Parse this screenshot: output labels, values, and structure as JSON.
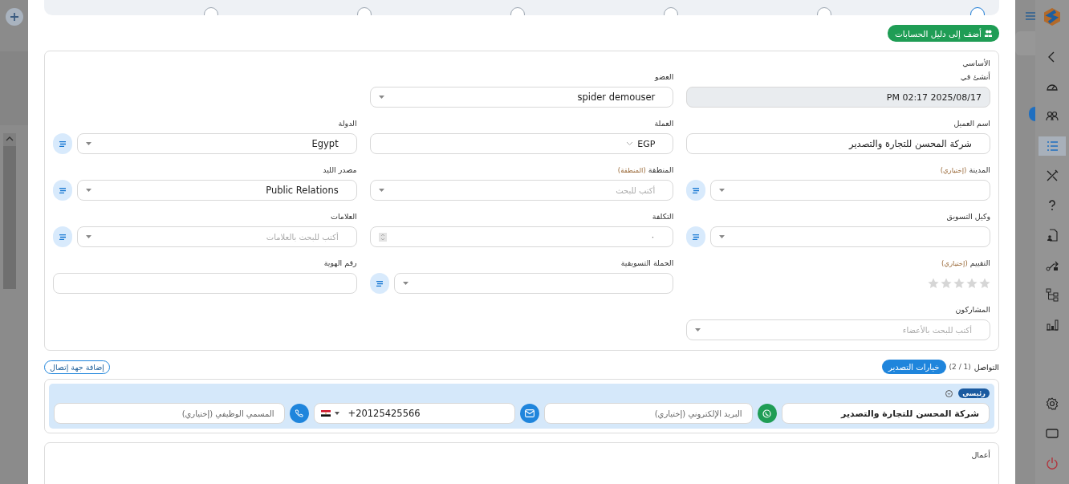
{
  "backdrop": {
    "sidebar": {
      "items": [
        {
          "kind": "back",
          "selected": false
        },
        {
          "kind": "gauge",
          "selected": false
        },
        {
          "kind": "people",
          "selected": false
        },
        {
          "kind": "list",
          "selected": true
        },
        {
          "kind": "tools",
          "selected": false
        },
        {
          "kind": "question",
          "selected": false
        },
        {
          "kind": "file",
          "selected": false
        },
        {
          "kind": "flow",
          "selected": false
        },
        {
          "kind": "tree",
          "selected": false
        },
        {
          "kind": "chart",
          "selected": false
        }
      ],
      "bottom_items": [
        {
          "kind": "gear",
          "selected": false
        },
        {
          "kind": "screen",
          "selected": false
        },
        {
          "kind": "power",
          "selected": false
        }
      ]
    }
  },
  "modal": {
    "stepper": {
      "steps": [
        {
          "selected": true
        },
        {
          "selected": false
        },
        {
          "selected": false
        },
        {
          "selected": false
        },
        {
          "selected": false
        },
        {
          "selected": false
        }
      ]
    },
    "add_to_accounts_button": "أضف إلى دليل الحسابات",
    "basic_section": {
      "title": "الأساسي",
      "rows": [
        [
          {
            "label": "أنشئ في",
            "kind": "readonly",
            "value": "PM 02:17 2025/08/17"
          },
          {
            "label": "العضو",
            "kind": "select",
            "value": "spider demouser"
          }
        ],
        [
          {
            "label": "اسم العميل",
            "kind": "input",
            "value": "شركة المحسن للتجارة والتصدير"
          },
          {
            "label": "العملة",
            "kind": "currency",
            "value": "EGP"
          },
          {
            "label": "الدولة",
            "kind": "select",
            "value": "Egypt",
            "side_button": true
          }
        ],
        [
          {
            "label": "المدينة",
            "hint": "(إختياري)",
            "kind": "select",
            "side_button": true
          },
          {
            "label": "المنطقة",
            "hint": "(المنطقة)",
            "kind": "select",
            "placeholder": "أكتب للبحث"
          },
          {
            "label": "مصدر الليد",
            "kind": "select",
            "value": "Public Relations",
            "side_button": true
          }
        ],
        [
          {
            "label": "وكيل التسويق",
            "kind": "select",
            "side_button": true
          },
          {
            "label": "التكلفة",
            "kind": "number",
            "placeholder": "٠"
          },
          {
            "label": "العلامات",
            "kind": "select",
            "placeholder": "أكتب للبحث بالعلامات",
            "side_button": true
          }
        ],
        [
          {
            "label": "التقييم",
            "hint": "(إختياري)",
            "kind": "stars",
            "stars": 0
          },
          {
            "label": "الحملة التسويقية",
            "kind": "select",
            "side_button": true
          },
          {
            "label": "رقم الهوية",
            "kind": "input"
          }
        ],
        [
          {
            "label": "المشاركون",
            "kind": "select",
            "placeholder": "أكتب للبحث بالأعضاء"
          }
        ]
      ]
    },
    "contacts_section": {
      "title": "التواصل",
      "count": "(2 / 1)",
      "export_button": "خيارات التصدير",
      "add_contact_button": "إضافة جهة إتصال",
      "contacts": [
        {
          "expanded": true,
          "badge": "رئيسي",
          "name": "شركة المحسن للتجارة والتصدير",
          "email_placeholder": "البريد الإلكتروني (إختياري)",
          "phone": "+20125425566",
          "job_title_placeholder": "المسمي الوظيفي (إختياري)"
        }
      ]
    },
    "work_section": {
      "title": "أعمال"
    }
  }
}
